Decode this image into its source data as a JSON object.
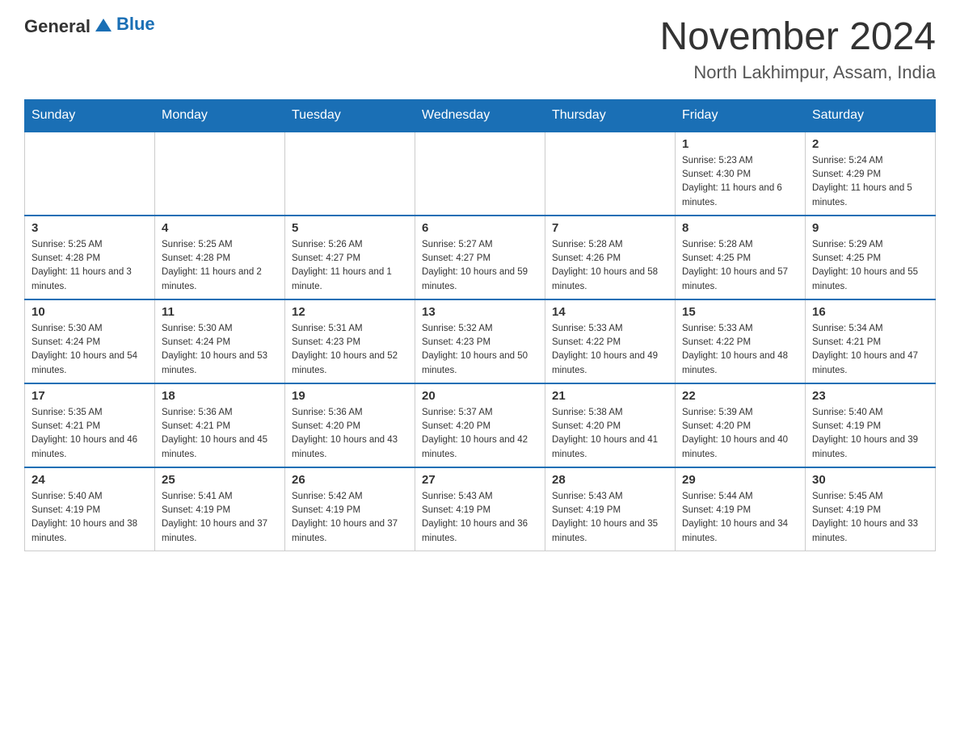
{
  "header": {
    "logo_text_general": "General",
    "logo_text_blue": "Blue",
    "month_title": "November 2024",
    "location": "North Lakhimpur, Assam, India"
  },
  "days_of_week": [
    "Sunday",
    "Monday",
    "Tuesday",
    "Wednesday",
    "Thursday",
    "Friday",
    "Saturday"
  ],
  "weeks": [
    {
      "days": [
        {
          "num": "",
          "sunrise": "",
          "sunset": "",
          "daylight": ""
        },
        {
          "num": "",
          "sunrise": "",
          "sunset": "",
          "daylight": ""
        },
        {
          "num": "",
          "sunrise": "",
          "sunset": "",
          "daylight": ""
        },
        {
          "num": "",
          "sunrise": "",
          "sunset": "",
          "daylight": ""
        },
        {
          "num": "",
          "sunrise": "",
          "sunset": "",
          "daylight": ""
        },
        {
          "num": "1",
          "sunrise": "Sunrise: 5:23 AM",
          "sunset": "Sunset: 4:30 PM",
          "daylight": "Daylight: 11 hours and 6 minutes."
        },
        {
          "num": "2",
          "sunrise": "Sunrise: 5:24 AM",
          "sunset": "Sunset: 4:29 PM",
          "daylight": "Daylight: 11 hours and 5 minutes."
        }
      ]
    },
    {
      "days": [
        {
          "num": "3",
          "sunrise": "Sunrise: 5:25 AM",
          "sunset": "Sunset: 4:28 PM",
          "daylight": "Daylight: 11 hours and 3 minutes."
        },
        {
          "num": "4",
          "sunrise": "Sunrise: 5:25 AM",
          "sunset": "Sunset: 4:28 PM",
          "daylight": "Daylight: 11 hours and 2 minutes."
        },
        {
          "num": "5",
          "sunrise": "Sunrise: 5:26 AM",
          "sunset": "Sunset: 4:27 PM",
          "daylight": "Daylight: 11 hours and 1 minute."
        },
        {
          "num": "6",
          "sunrise": "Sunrise: 5:27 AM",
          "sunset": "Sunset: 4:27 PM",
          "daylight": "Daylight: 10 hours and 59 minutes."
        },
        {
          "num": "7",
          "sunrise": "Sunrise: 5:28 AM",
          "sunset": "Sunset: 4:26 PM",
          "daylight": "Daylight: 10 hours and 58 minutes."
        },
        {
          "num": "8",
          "sunrise": "Sunrise: 5:28 AM",
          "sunset": "Sunset: 4:25 PM",
          "daylight": "Daylight: 10 hours and 57 minutes."
        },
        {
          "num": "9",
          "sunrise": "Sunrise: 5:29 AM",
          "sunset": "Sunset: 4:25 PM",
          "daylight": "Daylight: 10 hours and 55 minutes."
        }
      ]
    },
    {
      "days": [
        {
          "num": "10",
          "sunrise": "Sunrise: 5:30 AM",
          "sunset": "Sunset: 4:24 PM",
          "daylight": "Daylight: 10 hours and 54 minutes."
        },
        {
          "num": "11",
          "sunrise": "Sunrise: 5:30 AM",
          "sunset": "Sunset: 4:24 PM",
          "daylight": "Daylight: 10 hours and 53 minutes."
        },
        {
          "num": "12",
          "sunrise": "Sunrise: 5:31 AM",
          "sunset": "Sunset: 4:23 PM",
          "daylight": "Daylight: 10 hours and 52 minutes."
        },
        {
          "num": "13",
          "sunrise": "Sunrise: 5:32 AM",
          "sunset": "Sunset: 4:23 PM",
          "daylight": "Daylight: 10 hours and 50 minutes."
        },
        {
          "num": "14",
          "sunrise": "Sunrise: 5:33 AM",
          "sunset": "Sunset: 4:22 PM",
          "daylight": "Daylight: 10 hours and 49 minutes."
        },
        {
          "num": "15",
          "sunrise": "Sunrise: 5:33 AM",
          "sunset": "Sunset: 4:22 PM",
          "daylight": "Daylight: 10 hours and 48 minutes."
        },
        {
          "num": "16",
          "sunrise": "Sunrise: 5:34 AM",
          "sunset": "Sunset: 4:21 PM",
          "daylight": "Daylight: 10 hours and 47 minutes."
        }
      ]
    },
    {
      "days": [
        {
          "num": "17",
          "sunrise": "Sunrise: 5:35 AM",
          "sunset": "Sunset: 4:21 PM",
          "daylight": "Daylight: 10 hours and 46 minutes."
        },
        {
          "num": "18",
          "sunrise": "Sunrise: 5:36 AM",
          "sunset": "Sunset: 4:21 PM",
          "daylight": "Daylight: 10 hours and 45 minutes."
        },
        {
          "num": "19",
          "sunrise": "Sunrise: 5:36 AM",
          "sunset": "Sunset: 4:20 PM",
          "daylight": "Daylight: 10 hours and 43 minutes."
        },
        {
          "num": "20",
          "sunrise": "Sunrise: 5:37 AM",
          "sunset": "Sunset: 4:20 PM",
          "daylight": "Daylight: 10 hours and 42 minutes."
        },
        {
          "num": "21",
          "sunrise": "Sunrise: 5:38 AM",
          "sunset": "Sunset: 4:20 PM",
          "daylight": "Daylight: 10 hours and 41 minutes."
        },
        {
          "num": "22",
          "sunrise": "Sunrise: 5:39 AM",
          "sunset": "Sunset: 4:20 PM",
          "daylight": "Daylight: 10 hours and 40 minutes."
        },
        {
          "num": "23",
          "sunrise": "Sunrise: 5:40 AM",
          "sunset": "Sunset: 4:19 PM",
          "daylight": "Daylight: 10 hours and 39 minutes."
        }
      ]
    },
    {
      "days": [
        {
          "num": "24",
          "sunrise": "Sunrise: 5:40 AM",
          "sunset": "Sunset: 4:19 PM",
          "daylight": "Daylight: 10 hours and 38 minutes."
        },
        {
          "num": "25",
          "sunrise": "Sunrise: 5:41 AM",
          "sunset": "Sunset: 4:19 PM",
          "daylight": "Daylight: 10 hours and 37 minutes."
        },
        {
          "num": "26",
          "sunrise": "Sunrise: 5:42 AM",
          "sunset": "Sunset: 4:19 PM",
          "daylight": "Daylight: 10 hours and 37 minutes."
        },
        {
          "num": "27",
          "sunrise": "Sunrise: 5:43 AM",
          "sunset": "Sunset: 4:19 PM",
          "daylight": "Daylight: 10 hours and 36 minutes."
        },
        {
          "num": "28",
          "sunrise": "Sunrise: 5:43 AM",
          "sunset": "Sunset: 4:19 PM",
          "daylight": "Daylight: 10 hours and 35 minutes."
        },
        {
          "num": "29",
          "sunrise": "Sunrise: 5:44 AM",
          "sunset": "Sunset: 4:19 PM",
          "daylight": "Daylight: 10 hours and 34 minutes."
        },
        {
          "num": "30",
          "sunrise": "Sunrise: 5:45 AM",
          "sunset": "Sunset: 4:19 PM",
          "daylight": "Daylight: 10 hours and 33 minutes."
        }
      ]
    }
  ]
}
